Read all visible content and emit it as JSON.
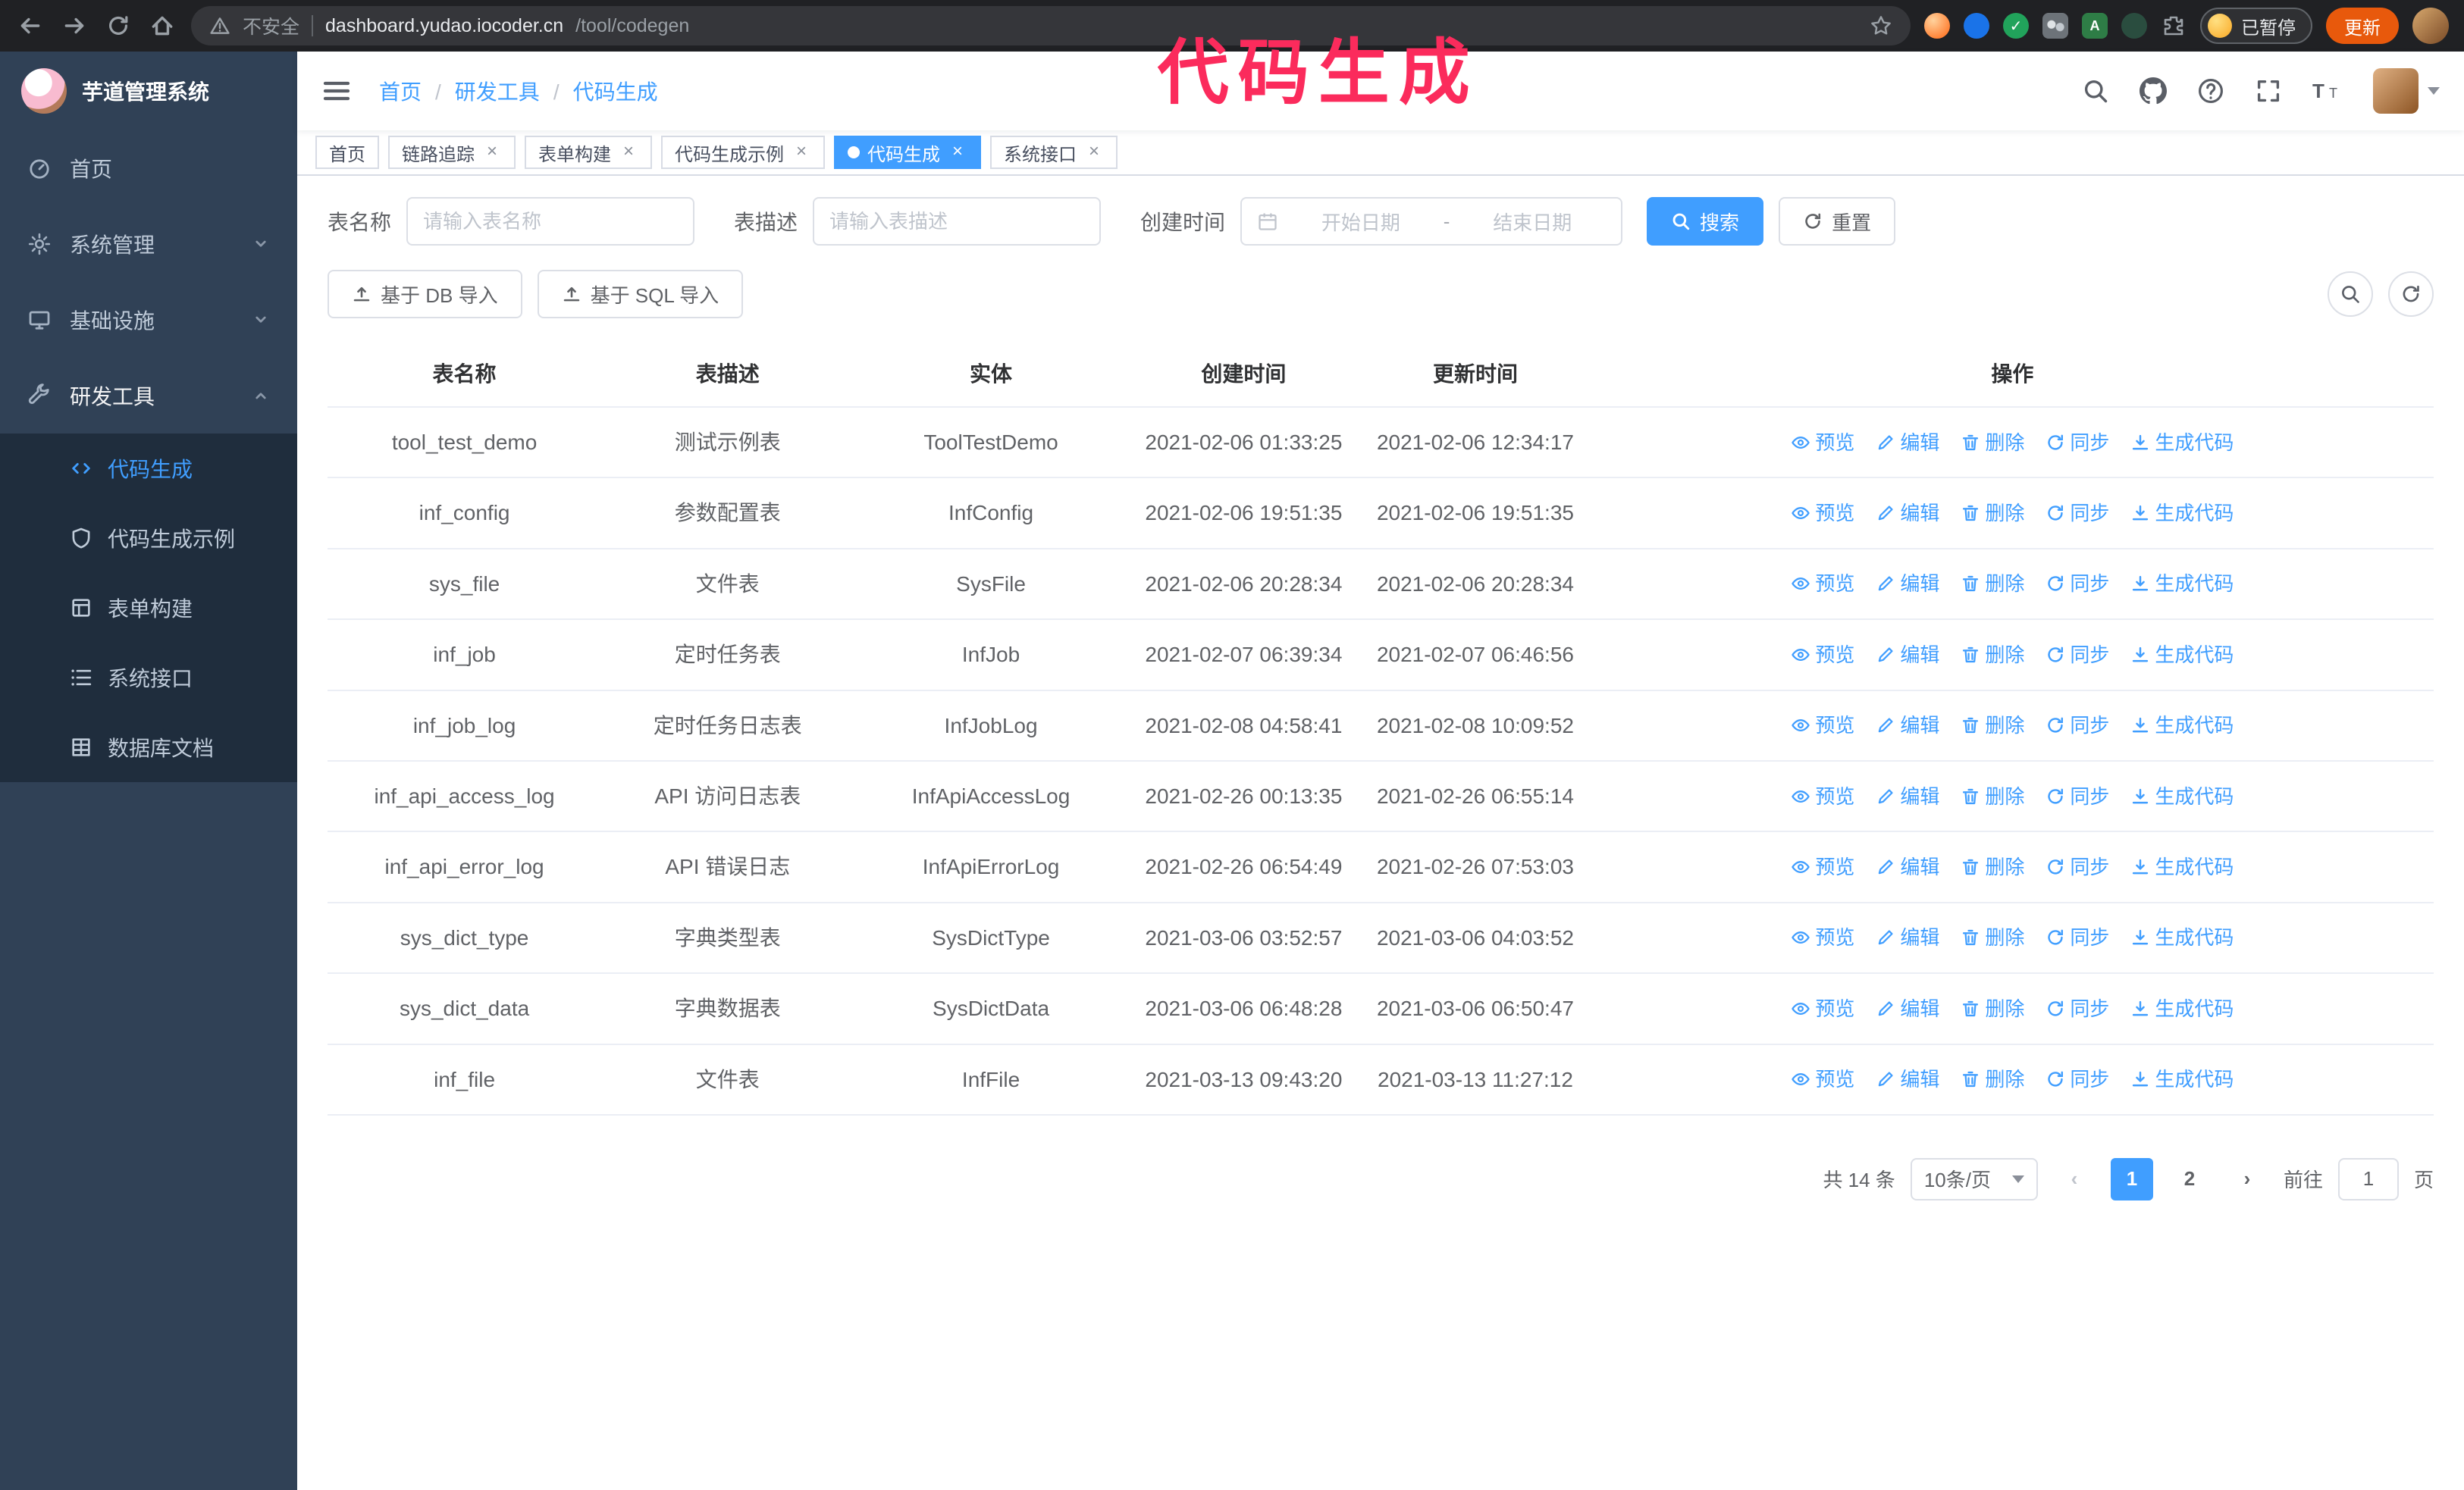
{
  "colors": {
    "accent": "#409eff",
    "sidebar_bg": "#304156",
    "submenu_bg": "#1f2d3d",
    "annotation": "#fb2b5c",
    "update_button_bg": "#e8590c"
  },
  "annotation": {
    "text": "代码生成"
  },
  "browser": {
    "security_label": "不安全",
    "url_domain": "dashboard.yudao.iocoder.cn",
    "url_path": "/tool/codegen",
    "paused_badge": "已暂停",
    "update_button": "更新"
  },
  "sidebar": {
    "logo_title": "芋道管理系统",
    "menu": [
      {
        "label": "首页"
      },
      {
        "label": "系统管理"
      },
      {
        "label": "基础设施"
      },
      {
        "label": "研发工具"
      }
    ],
    "submenu": [
      {
        "label": "代码生成"
      },
      {
        "label": "代码生成示例"
      },
      {
        "label": "表单构建"
      },
      {
        "label": "系统接口"
      },
      {
        "label": "数据库文档"
      }
    ]
  },
  "navbar": {
    "breadcrumb": [
      "首页",
      "研发工具",
      "代码生成"
    ]
  },
  "tags": [
    {
      "label": "首页"
    },
    {
      "label": "链路追踪"
    },
    {
      "label": "表单构建"
    },
    {
      "label": "代码生成示例"
    },
    {
      "label": "代码生成"
    },
    {
      "label": "系统接口"
    }
  ],
  "filters": {
    "name_label": "表名称",
    "name_placeholder": "请输入表名称",
    "desc_label": "表描述",
    "desc_placeholder": "请输入表描述",
    "time_label": "创建时间",
    "start_placeholder": "开始日期",
    "range_separator": "-",
    "end_placeholder": "结束日期",
    "search_button": "搜索",
    "reset_button": "重置"
  },
  "toolbar": {
    "import_db": "基于 DB 导入",
    "import_sql": "基于 SQL 导入"
  },
  "table": {
    "columns": [
      "表名称",
      "表描述",
      "实体",
      "创建时间",
      "更新时间",
      "操作"
    ],
    "action_labels": [
      "预览",
      "编辑",
      "删除",
      "同步",
      "生成代码"
    ],
    "rows": [
      {
        "name": "tool_test_demo",
        "desc": "测试示例表",
        "entity": "ToolTestDemo",
        "created": "2021-02-06 01:33:25",
        "updated": "2021-02-06 12:34:17"
      },
      {
        "name": "inf_config",
        "desc": "参数配置表",
        "entity": "InfConfig",
        "created": "2021-02-06 19:51:35",
        "updated": "2021-02-06 19:51:35"
      },
      {
        "name": "sys_file",
        "desc": "文件表",
        "entity": "SysFile",
        "created": "2021-02-06 20:28:34",
        "updated": "2021-02-06 20:28:34"
      },
      {
        "name": "inf_job",
        "desc": "定时任务表",
        "entity": "InfJob",
        "created": "2021-02-07 06:39:34",
        "updated": "2021-02-07 06:46:56"
      },
      {
        "name": "inf_job_log",
        "desc": "定时任务日志表",
        "entity": "InfJobLog",
        "created": "2021-02-08 04:58:41",
        "updated": "2021-02-08 10:09:52"
      },
      {
        "name": "inf_api_access_log",
        "desc": "API 访问日志表",
        "entity": "InfApiAccessLog",
        "created": "2021-02-26 00:13:35",
        "updated": "2021-02-26 06:55:14"
      },
      {
        "name": "inf_api_error_log",
        "desc": "API 错误日志",
        "entity": "InfApiErrorLog",
        "created": "2021-02-26 06:54:49",
        "updated": "2021-02-26 07:53:03"
      },
      {
        "name": "sys_dict_type",
        "desc": "字典类型表",
        "entity": "SysDictType",
        "created": "2021-03-06 03:52:57",
        "updated": "2021-03-06 04:03:52"
      },
      {
        "name": "sys_dict_data",
        "desc": "字典数据表",
        "entity": "SysDictData",
        "created": "2021-03-06 06:48:28",
        "updated": "2021-03-06 06:50:47"
      },
      {
        "name": "inf_file",
        "desc": "文件表",
        "entity": "InfFile",
        "created": "2021-03-13 09:43:20",
        "updated": "2021-03-13 11:27:12"
      }
    ]
  },
  "pagination": {
    "total": "共 14 条",
    "page_size": "10条/页",
    "pages": [
      "1",
      "2"
    ],
    "active_page": "1",
    "goto_label": "前往",
    "goto_value": "1",
    "page_unit": "页"
  }
}
